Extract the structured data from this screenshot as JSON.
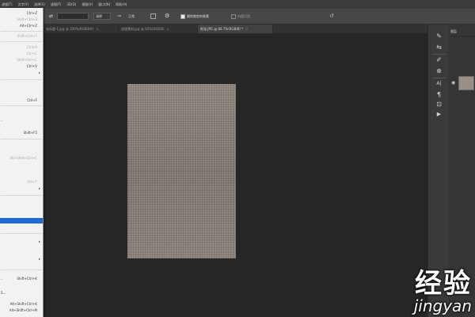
{
  "menubar": {
    "items": [
      "滤镜(T)",
      "文字(Y)",
      "选择(S)",
      "滤镜(T)",
      "3D(D)",
      "视图(V)",
      "窗口(W)",
      "帮助(H)"
    ]
  },
  "options": {
    "brush_value": "",
    "mode_label": "清除",
    "fill_label": "正常",
    "check1_label": "删除裁剪的像素",
    "check2_label": "内容识别"
  },
  "tabs": [
    {
      "label": "未标题-1.jpg @ 100%(RGB/8#)",
      "close": "×"
    },
    {
      "label": "纹理素材.jpg @ 50%(RGB/8)",
      "close": "×"
    },
    {
      "label": "纸张.JPG @ 66.7%(RGB/8) *",
      "close": "×",
      "active": true
    }
  ],
  "edit_menu": [
    {
      "label": "",
      "shortcut": "Ctrl+Z"
    },
    {
      "label": "",
      "shortcut": "Shift+Ctrl+Z",
      "disabled": true
    },
    {
      "label": "",
      "shortcut": "Alt+Ctrl+Z"
    },
    {
      "label": "",
      "shortcut": "Shift+Ctrl+F",
      "disabled": true
    },
    {
      "label": "",
      "shortcut": "Ctrl+X",
      "disabled": true
    },
    {
      "label": "",
      "shortcut": "Ctrl+C",
      "disabled": true
    },
    {
      "label": "",
      "shortcut": "Shift+Ctrl+C",
      "disabled": true
    },
    {
      "label": "",
      "shortcut": "Ctrl+V"
    },
    {
      "label": "",
      "shortcut": "Ctrl+F"
    },
    {
      "label": "..",
      "shortcut": ""
    },
    {
      "label": "",
      "shortcut": "Shift+F5"
    },
    {
      "label": "",
      "shortcut": "Alt+Shift+Ctrl+C",
      "disabled": true
    },
    {
      "label": "",
      "shortcut": "Ctrl+T",
      "disabled": true
    },
    {
      "label": "",
      "shortcut": ""
    },
    {
      "label": "..",
      "shortcut": "Shift+Ctrl+K"
    },
    {
      "label": "5...",
      "shortcut": ""
    },
    {
      "label": "",
      "shortcut": "Alt+Shift+Ctrl+K"
    },
    {
      "label": "",
      "shortcut": "Alt+Shift+Ctrl+M"
    }
  ],
  "panel": {
    "tab_label": "图层"
  },
  "watermark": {
    "line1": "经验",
    "line2": "jingyan"
  }
}
